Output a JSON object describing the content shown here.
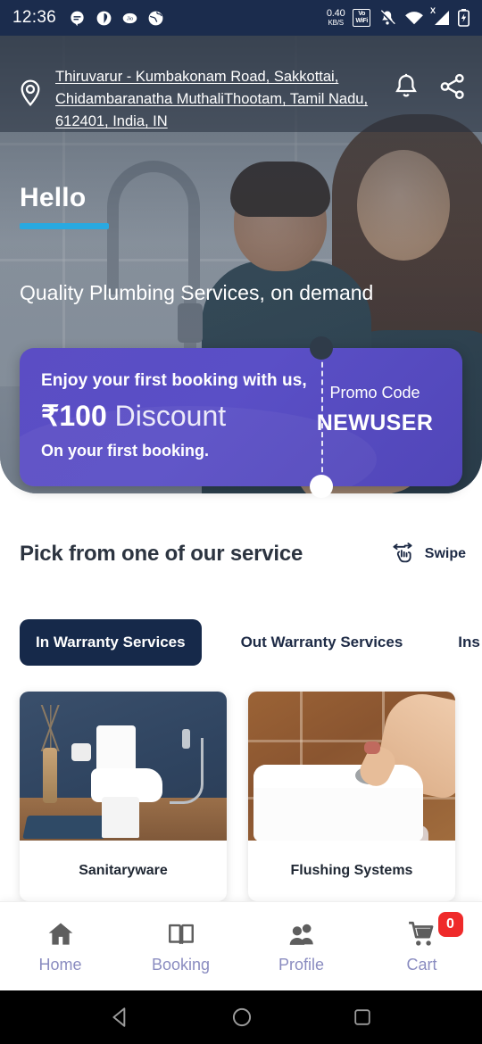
{
  "statusbar": {
    "time": "12:36",
    "left_icons": [
      "message-icon",
      "phonepe-icon",
      "jio-icon",
      "globe-icon"
    ],
    "data_speed_value": "0.40",
    "data_speed_unit": "KB/S",
    "vowifi_line1": "Vo",
    "vowifi_line2": "WiFi",
    "signal_x": "X",
    "right_icons": [
      "notifications-muted-icon",
      "wifi-icon",
      "cellular-signal-icon",
      "battery-charging-icon"
    ]
  },
  "header": {
    "location_icon": "location-pin-icon",
    "address": "Thiruvarur - Kumbakonam Road, Sakkottai, Chidambaranatha MuthaliThootam, Tamil Nadu, 612401, India, IN",
    "notification_icon": "bell-icon",
    "share_icon": "share-icon"
  },
  "hero": {
    "greeting": "Hello",
    "tagline": "Quality Plumbing Services, on demand",
    "accent_color": "#29a9e1"
  },
  "promo": {
    "headline": "Enjoy your first booking with us,",
    "amount": "₹100",
    "amount_suffix": " Discount",
    "subtext": "On your first booking.",
    "code_label": "Promo Code",
    "code": "NEWUSER",
    "background_color": "#5b4dc4"
  },
  "services_section": {
    "title": "Pick from one of our service",
    "swipe_label": "Swipe",
    "swipe_icon": "swipe-hand-icon",
    "tabs": [
      {
        "label": "In Warranty Services",
        "active": true
      },
      {
        "label": "Out Warranty Services",
        "active": false
      },
      {
        "label": "Ins",
        "active": false
      }
    ],
    "cards": [
      {
        "title": "Sanitaryware"
      },
      {
        "title": "Flushing Systems"
      }
    ]
  },
  "bottom_nav": {
    "items": [
      {
        "label": "Home",
        "icon": "home-icon"
      },
      {
        "label": "Booking",
        "icon": "book-icon"
      },
      {
        "label": "Profile",
        "icon": "people-icon"
      },
      {
        "label": "Cart",
        "icon": "cart-icon"
      }
    ],
    "cart_badge": "0",
    "badge_color": "#ef2a2a",
    "label_color": "#8a8cc0"
  },
  "android_nav": {
    "back": "back-triangle-icon",
    "home": "home-circle-icon",
    "recents": "recents-square-icon"
  }
}
